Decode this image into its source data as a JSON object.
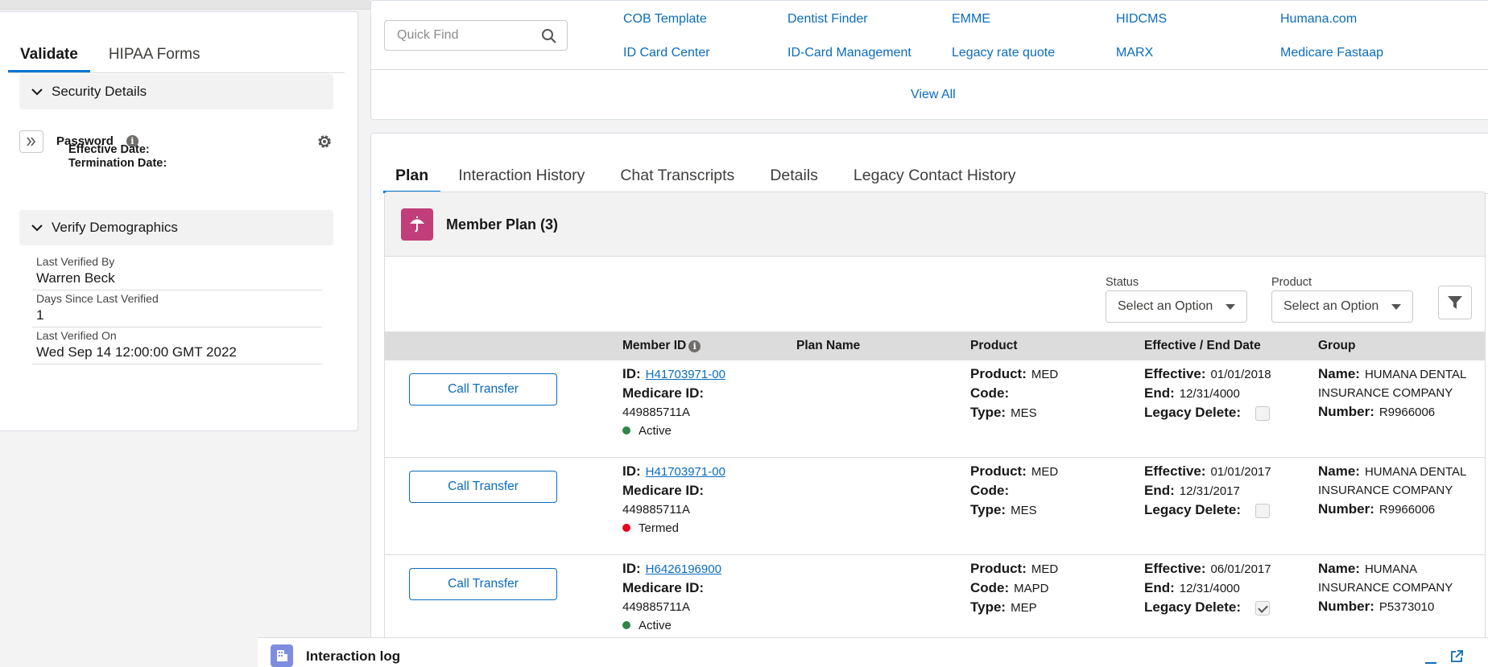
{
  "left_panel": {
    "tabs": [
      {
        "label": "Validate",
        "active": true
      },
      {
        "label": "HIPAA Forms",
        "active": false
      }
    ],
    "security_section": {
      "title": "Security Details",
      "password_label": "Password",
      "effective_date_label": "Effective Date:",
      "termination_date_label": "Termination Date:"
    },
    "demographics_section": {
      "title": "Verify Demographics",
      "fields": [
        {
          "label": "Last Verified By",
          "value": "Warren Beck"
        },
        {
          "label": "Days Since Last Verified",
          "value": "1"
        },
        {
          "label": "Last Verified On",
          "value": "Wed Sep 14 12:00:00 GMT 2022"
        }
      ]
    }
  },
  "quick_find": {
    "placeholder": "Quick Find",
    "links": [
      "COB Template",
      "Dentist Finder",
      "EMME",
      "HIDCMS",
      "Humana.com",
      "ID Card Center",
      "ID-Card Management",
      "Legacy rate quote",
      "MARX",
      "Medicare Fastaap"
    ],
    "view_all": "View All"
  },
  "main": {
    "tabs": [
      {
        "label": "Plan",
        "active": true
      },
      {
        "label": "Interaction History",
        "active": false
      },
      {
        "label": "Chat Transcripts",
        "active": false
      },
      {
        "label": "Details",
        "active": false
      },
      {
        "label": "Legacy Contact History",
        "active": false
      }
    ],
    "member_plan": {
      "title": "Member Plan (3)",
      "filters": {
        "status_label": "Status",
        "status_value": "Select an Option",
        "product_label": "Product",
        "product_value": "Select an Option"
      },
      "columns": [
        "Member ID",
        "Plan Name",
        "Product",
        "Effective / End Date",
        "Group"
      ],
      "rows": [
        {
          "button": "Call Transfer",
          "id_label": "ID:",
          "id": "H41703971-00",
          "medicare_label": "Medicare ID:",
          "medicare_id": "449885711A",
          "status": "Active",
          "status_color": "#2e844a",
          "product_label": "Product:",
          "product": "MED",
          "code_label": "Code:",
          "code": "",
          "type_label": "Type:",
          "type": "MES",
          "effective_label": "Effective:",
          "effective": "01/01/2018",
          "end_label": "End:",
          "end": "12/31/4000",
          "legacy_label": "Legacy Delete:",
          "legacy_checked": false,
          "name_label": "Name:",
          "group_name_1": "HUMANA DENTAL",
          "group_name_2": "INSURANCE COMPANY",
          "number_label": "Number:",
          "group_number": "R9966006"
        },
        {
          "button": "Call Transfer",
          "id_label": "ID:",
          "id": "H41703971-00",
          "medicare_label": "Medicare ID:",
          "medicare_id": "449885711A",
          "status": "Termed",
          "status_color": "#ea001e",
          "product_label": "Product:",
          "product": "MED",
          "code_label": "Code:",
          "code": "",
          "type_label": "Type:",
          "type": "MES",
          "effective_label": "Effective:",
          "effective": "01/01/2017",
          "end_label": "End:",
          "end": "12/31/2017",
          "legacy_label": "Legacy Delete:",
          "legacy_checked": false,
          "name_label": "Name:",
          "group_name_1": "HUMANA DENTAL",
          "group_name_2": "INSURANCE COMPANY",
          "number_label": "Number:",
          "group_number": "R9966006"
        },
        {
          "button": "Call Transfer",
          "id_label": "ID:",
          "id": "H6426196900",
          "medicare_label": "Medicare ID:",
          "medicare_id": "449885711A",
          "status": "Active",
          "status_color": "#2e844a",
          "product_label": "Product:",
          "product": "MED",
          "code_label": "Code:",
          "code": "MAPD",
          "type_label": "Type:",
          "type": "MEP",
          "effective_label": "Effective:",
          "effective": "06/01/2017",
          "end_label": "End:",
          "end": "12/31/4000",
          "legacy_label": "Legacy Delete:",
          "legacy_checked": true,
          "name_label": "Name:",
          "group_name_1": "HUMANA",
          "group_name_2": "INSURANCE COMPANY",
          "number_label": "Number:",
          "group_number": "P5373010"
        }
      ]
    }
  },
  "bottom_bar": {
    "title": "Interaction log"
  },
  "colors": {
    "link": "#0b6cbd",
    "accent": "#0176d3",
    "plan_icon": "#c23e7a",
    "log_icon": "#7f8de1"
  }
}
